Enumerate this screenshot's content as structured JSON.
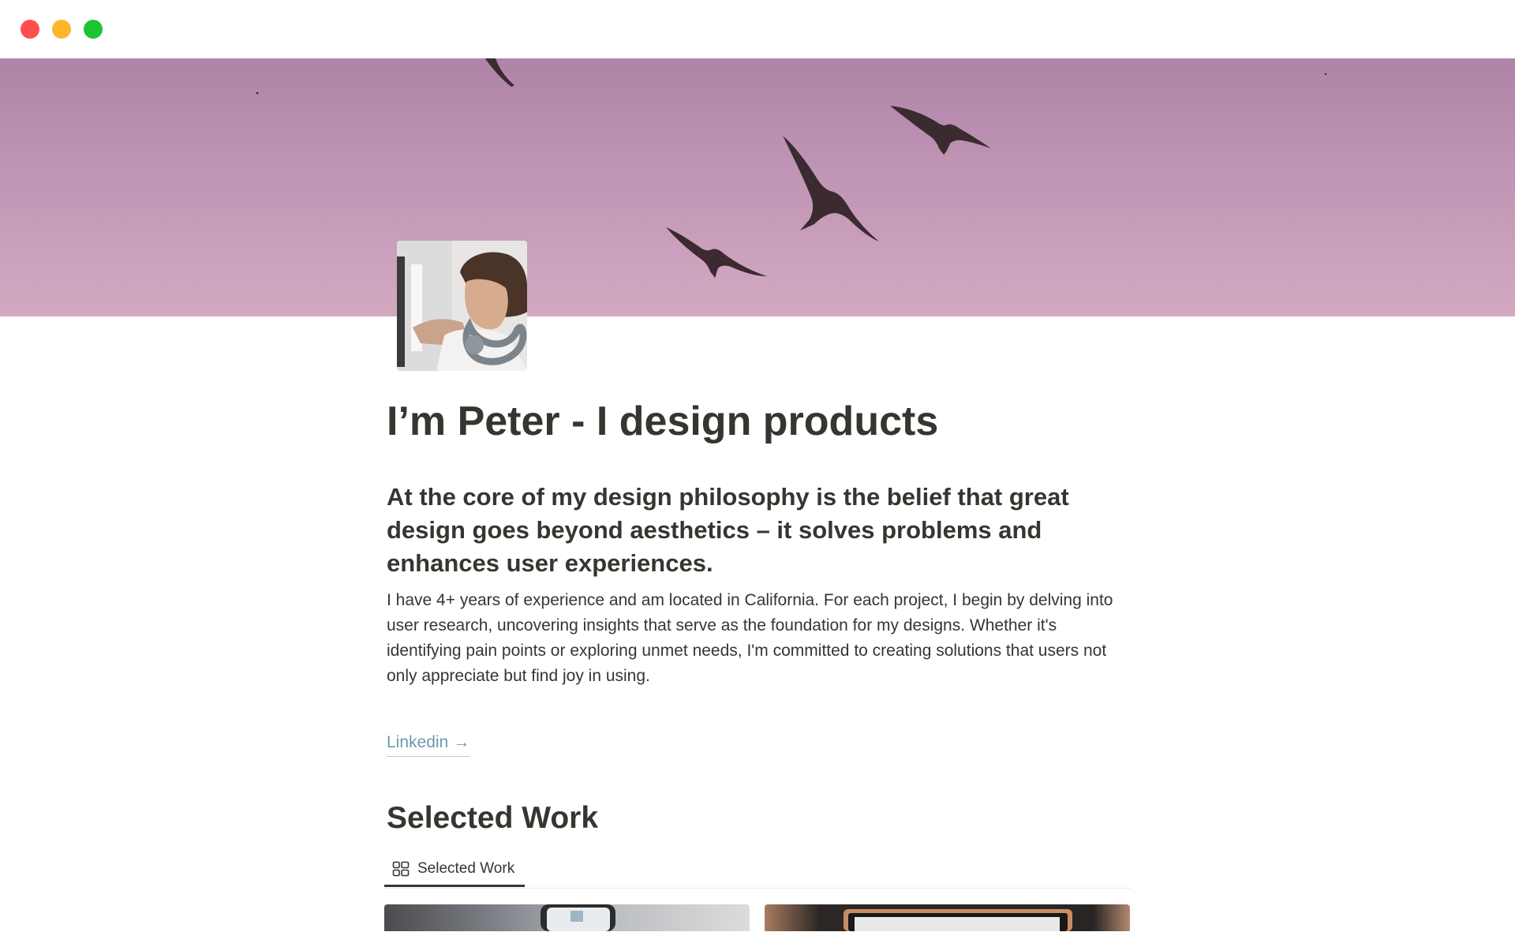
{
  "window": {
    "controls": [
      "close",
      "minimize",
      "zoom"
    ]
  },
  "cover": {
    "description_icon": "birds-cover-image"
  },
  "profile": {
    "avatar_icon": "person-headphones-photo"
  },
  "page": {
    "title": "I’m Peter - I design products",
    "subheading": "At the core of my design philosophy is the belief that great design goes beyond aesthetics – it solves problems and enhances user experiences.",
    "bio": "I have 4+ years of experience and am located in California. For each project, I begin by delving into user research, uncovering insights that serve as the foundation for my designs. Whether it's identifying pain points or exploring unmet needs, I'm committed to creating solutions that users not only appreciate but find joy in using.",
    "link_label": "Linkedin",
    "link_arrow": "→"
  },
  "selected_work": {
    "heading": "Selected Work",
    "tabs": [
      {
        "label": "Selected Work",
        "icon": "gallery-grid-icon",
        "active": true
      }
    ]
  },
  "colors": {
    "text": "#37352f",
    "link": "#6f99ae",
    "close": "#fe4e4d",
    "minimize": "#fdb52c",
    "zoom": "#1fc431"
  }
}
